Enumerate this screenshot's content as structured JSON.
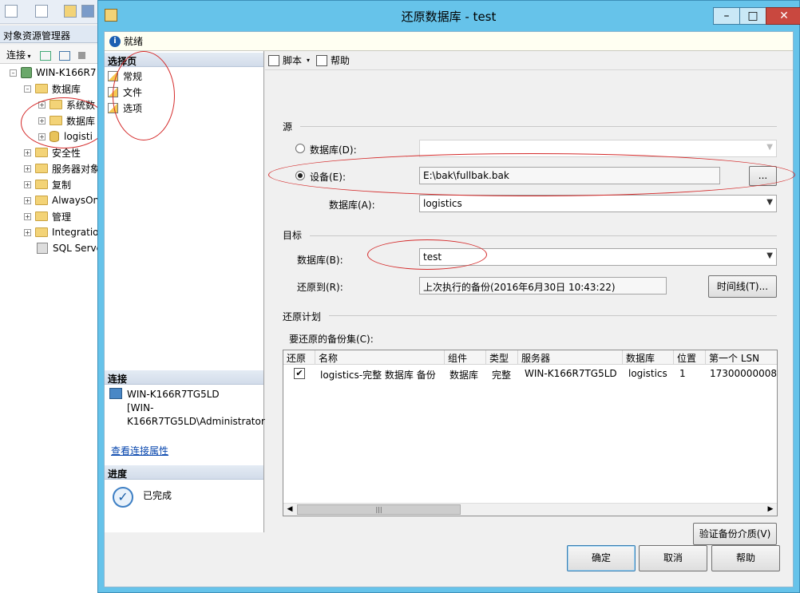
{
  "oe": {
    "title": "对象资源管理器",
    "connect_label": "连接",
    "tree": [
      "WIN-K166R7",
      "数据库",
      "系统数",
      "数据库",
      "logisti",
      "安全性",
      "服务器对象",
      "复制",
      "AlwaysOn",
      "管理",
      "Integratio",
      "SQL Serve"
    ]
  },
  "dialog": {
    "title": "还原数据库 - test",
    "status": "就绪",
    "window_buttons": {
      "minimize": "–",
      "maximize": "□",
      "close": "✕"
    }
  },
  "left": {
    "select_page_header": "选择页",
    "pages": [
      "常规",
      "文件",
      "选项"
    ],
    "connection_header": "连接",
    "connection_info": "WIN-K166R7TG5LD\n[WIN-K166R7TG5LD\\Administrator]",
    "connection_link": "查看连接属性",
    "progress_header": "进度",
    "progress_status": "已完成"
  },
  "toolbar": {
    "script": "脚本",
    "help": "帮助"
  },
  "source": {
    "group": "源",
    "database_option": "数据库(D):",
    "device_option": "设备(E):",
    "device_value": "E:\\bak\\fullbak.bak",
    "browse": "...",
    "database_label": "数据库(A):",
    "database_value": "logistics"
  },
  "target": {
    "group": "目标",
    "database_label": "数据库(B):",
    "database_value": "test",
    "restore_to_label": "还原到(R):",
    "restore_to_value": "上次执行的备份(2016年6月30日 10:43:22)",
    "timeline_button": "时间线(T)..."
  },
  "plan": {
    "group": "还原计划",
    "sets_label": "要还原的备份集(C):",
    "columns": [
      "还原",
      "名称",
      "组件",
      "类型",
      "服务器",
      "数据库",
      "位置",
      "第一个 LSN"
    ],
    "rows": [
      {
        "restore": true,
        "name": "logistics-完整 数据库 备份",
        "component": "数据库",
        "type": "完整",
        "server": "WIN-K166R7TG5LD",
        "database": "logistics",
        "position": "1",
        "first_lsn": "17300000008"
      }
    ],
    "verify_button": "验证备份介质(V)"
  },
  "footer": {
    "ok": "确定",
    "cancel": "取消",
    "help": "帮助"
  },
  "colors": {
    "title_bar": "#66c3ea",
    "annotation": "#d42a2a",
    "link": "#0645ad"
  }
}
